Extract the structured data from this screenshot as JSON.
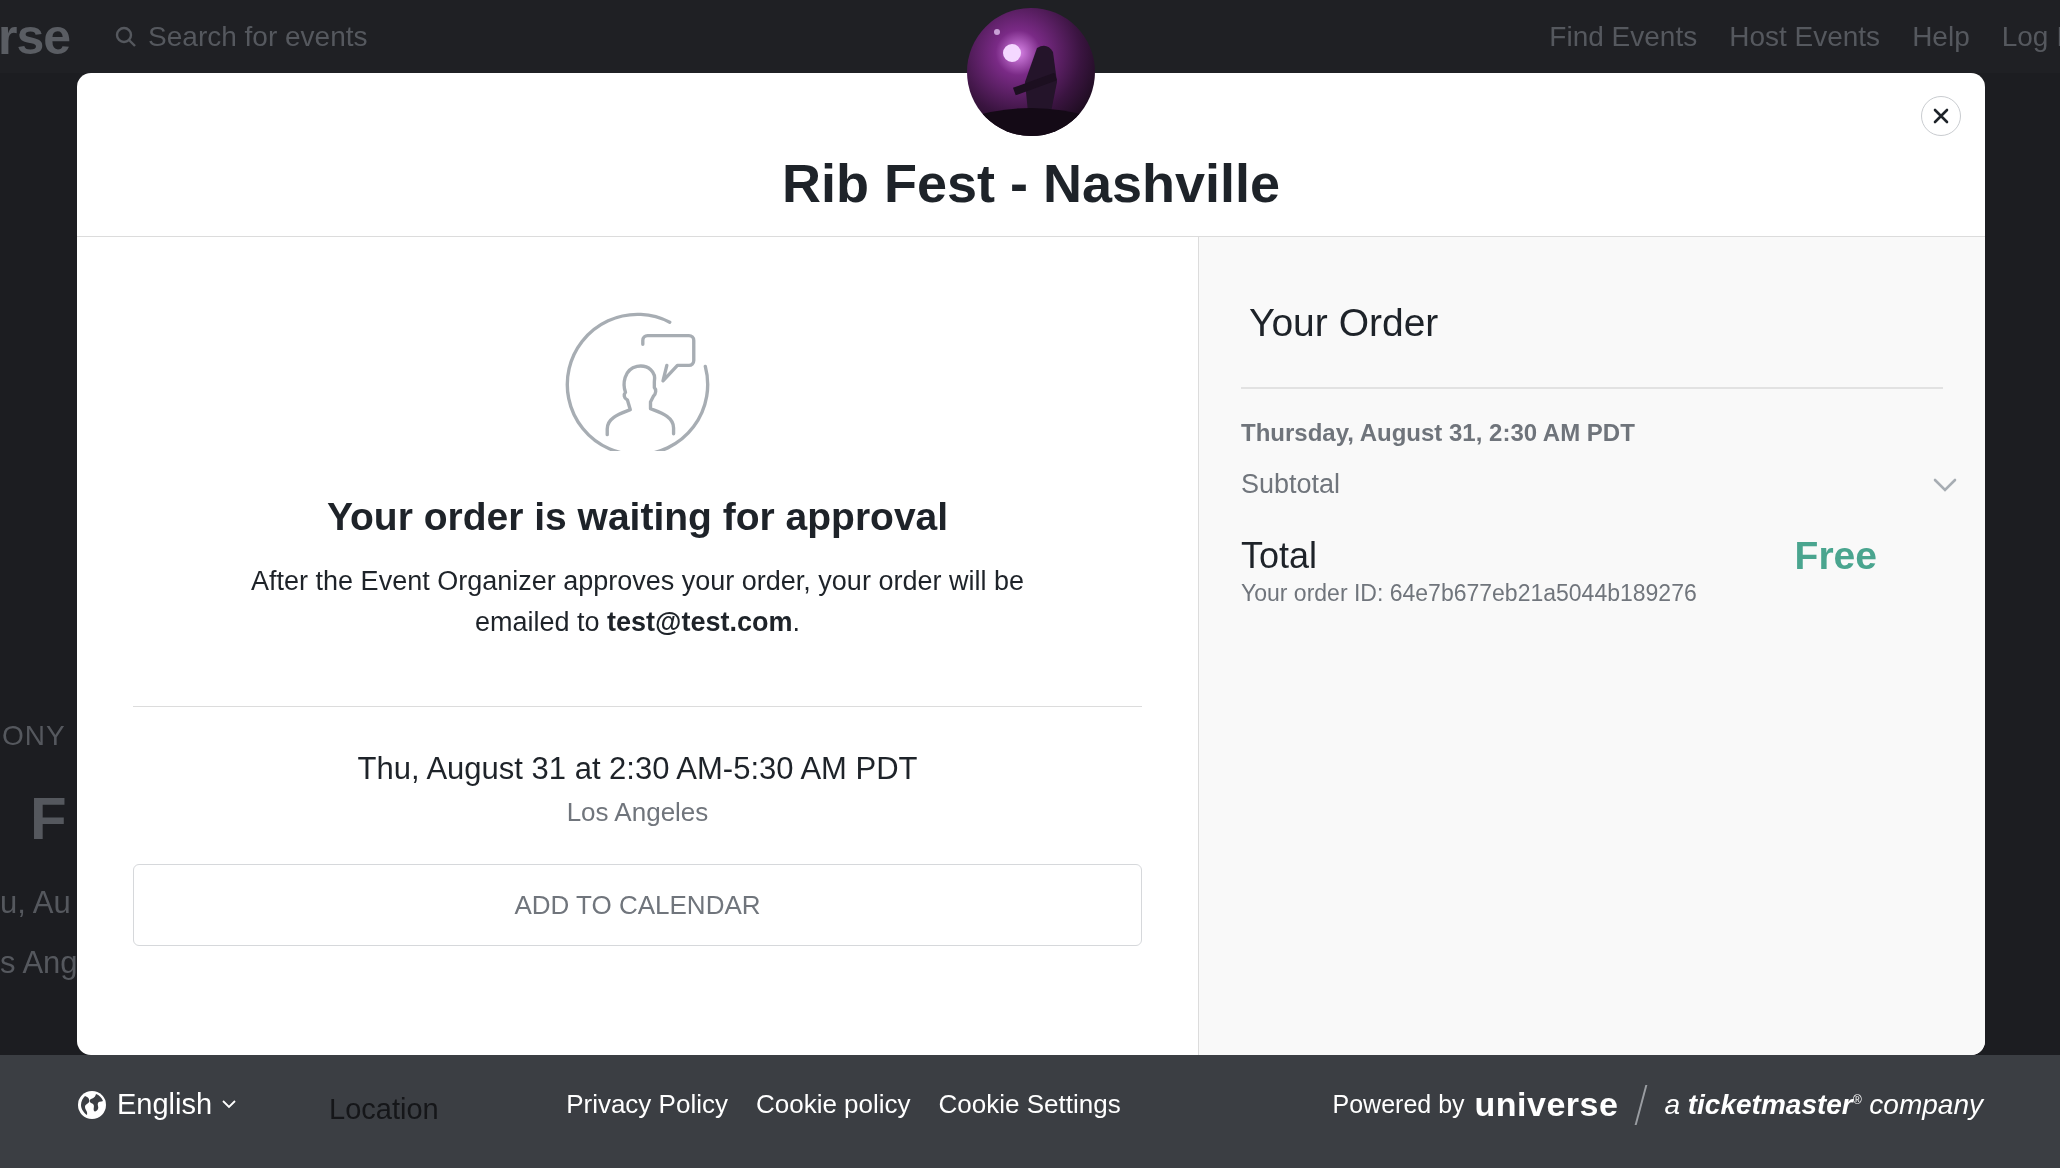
{
  "background_page": {
    "logo": "rse",
    "search": {
      "placeholder": "Search for events"
    },
    "nav": [
      "Find Events",
      "Host Events",
      "Help",
      "Log I"
    ],
    "event_label": "ONY",
    "event_title": "F",
    "event_date": "u, Au",
    "event_location": "s Ang",
    "section_tab": "Location"
  },
  "modal": {
    "title": "Rib Fest - Nashville",
    "status": {
      "heading": "Your order is waiting for approval",
      "message": "After the Event Organizer approves your order, your order will be emailed to **test@test.com**."
    },
    "event": {
      "datetime": "Thu, August 31 at 2:30 AM-5:30 AM PDT",
      "location": "Los Angeles"
    },
    "calendar_button": "ADD TO CALENDAR",
    "order": {
      "title": "Your Order",
      "date": "Thursday, August 31, 2:30 AM PDT",
      "subtotal_label": "Subtotal",
      "subtotal_expanded": false,
      "total_label": "Total",
      "total_value": "Free",
      "order_id": "Your order ID: 64e7b677eb21a5044b189276"
    }
  },
  "footer": {
    "language": "English",
    "links": [
      "Privacy Policy",
      "Cookie policy",
      "Cookie Settings"
    ],
    "powered_by": "Powered by",
    "brand": "universe",
    "tagline": "a **ticketmaster**$^{®}$ company"
  }
}
